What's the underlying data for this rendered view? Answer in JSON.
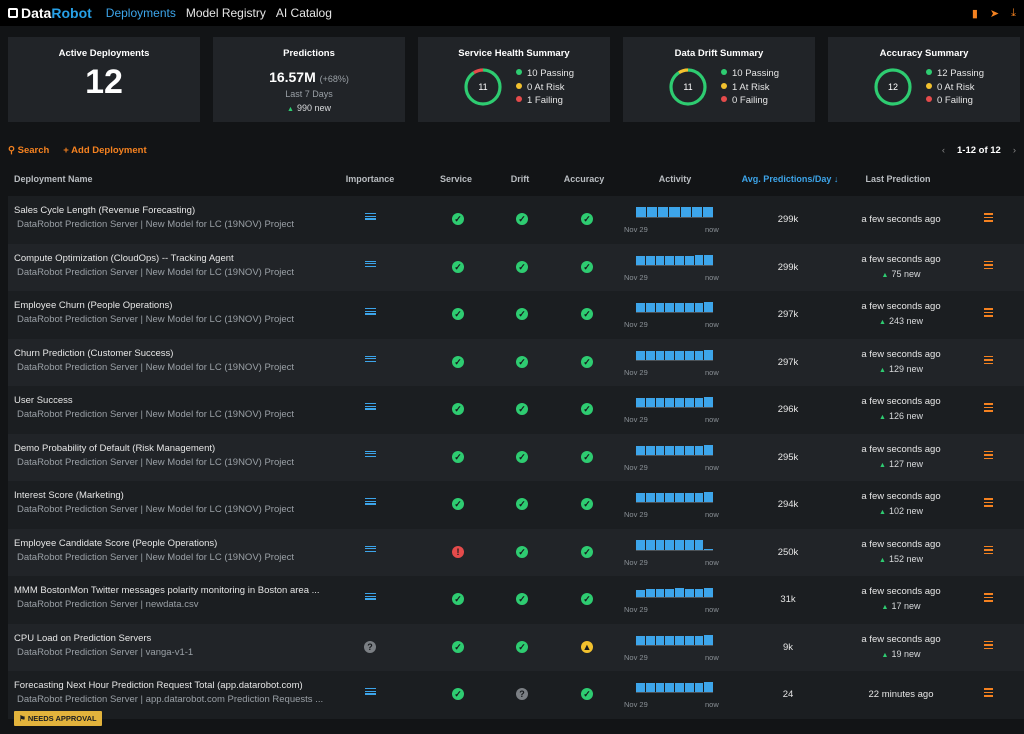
{
  "app": {
    "brand_part1": "Data",
    "brand_part2": "Robot",
    "nav": [
      "Deployments",
      "Model Registry",
      "AI Catalog"
    ]
  },
  "colors": {
    "accent_blue": "#3da5ea",
    "accent_orange": "#f58220",
    "pass": "#2ecc71",
    "risk": "#f2c12e",
    "fail": "#e54b4b"
  },
  "summary": {
    "active": {
      "title": "Active Deployments",
      "value": "12"
    },
    "predictions": {
      "title": "Predictions",
      "value": "16.57M",
      "change": "(+68%)",
      "period": "Last 7 Days",
      "new": "990 new"
    },
    "service": {
      "title": "Service Health Summary",
      "total": "11",
      "passing": "10 Passing",
      "at_risk": "0 At Risk",
      "failing": "1 Failing",
      "pass_count": 10,
      "risk_count": 0,
      "fail_count": 1
    },
    "drift": {
      "title": "Data Drift Summary",
      "total": "11",
      "passing": "10 Passing",
      "at_risk": "1 At Risk",
      "failing": "0 Failing",
      "pass_count": 10,
      "risk_count": 1,
      "fail_count": 0
    },
    "accuracy": {
      "title": "Accuracy Summary",
      "total": "12",
      "passing": "12 Passing",
      "at_risk": "0 At Risk",
      "failing": "0 Failing",
      "pass_count": 12,
      "risk_count": 0,
      "fail_count": 0
    }
  },
  "toolbar": {
    "search": "Search",
    "add": "Add Deployment",
    "pager": "1-12 of 12"
  },
  "table": {
    "headers": {
      "name": "Deployment Name",
      "importance": "Importance",
      "service": "Service",
      "drift": "Drift",
      "accuracy": "Accuracy",
      "activity": "Activity",
      "avg": "Avg. Predictions/Day",
      "last": "Last Prediction"
    },
    "activity_start": "Nov 29",
    "activity_end": "now",
    "rows": [
      {
        "name": "Sales Cycle Length (Revenue Forecasting)",
        "sub": "DataRobot Prediction Server | New Model for LC (19NOV) Project",
        "service": "ok",
        "drift": "ok",
        "accuracy": "ok",
        "importance": true,
        "activity": [
          0.8,
          0.8,
          0.8,
          0.8,
          0.8,
          0.8,
          0.85
        ],
        "avg": "299k",
        "last": "a few seconds ago",
        "new": ""
      },
      {
        "name": "Compute Optimization (CloudOps) -- Tracking Agent",
        "sub": "DataRobot Prediction Server | New Model for LC (19NOV) Project",
        "service": "ok",
        "drift": "ok",
        "accuracy": "ok",
        "importance": true,
        "activity": [
          0.75,
          0.75,
          0.75,
          0.75,
          0.75,
          0.75,
          0.8,
          0.8
        ],
        "avg": "299k",
        "last": "a few seconds ago",
        "new": "75 new"
      },
      {
        "name": "Employee Churn (People Operations)",
        "sub": "DataRobot Prediction Server | New Model for LC (19NOV) Project",
        "service": "ok",
        "drift": "ok",
        "accuracy": "ok",
        "importance": true,
        "activity": [
          0.75,
          0.75,
          0.75,
          0.75,
          0.75,
          0.75,
          0.75,
          0.8
        ],
        "avg": "297k",
        "last": "a few seconds ago",
        "new": "243 new"
      },
      {
        "name": "Churn Prediction (Customer Success)",
        "sub": "DataRobot Prediction Server | New Model for LC (19NOV) Project",
        "service": "ok",
        "drift": "ok",
        "accuracy": "ok",
        "importance": true,
        "activity": [
          0.75,
          0.75,
          0.75,
          0.75,
          0.75,
          0.75,
          0.75,
          0.8
        ],
        "avg": "297k",
        "last": "a few seconds ago",
        "new": "129 new"
      },
      {
        "name": "User Success",
        "sub": "DataRobot Prediction Server | New Model for LC (19NOV) Project",
        "service": "ok",
        "drift": "ok",
        "accuracy": "ok",
        "importance": true,
        "activity": [
          0.75,
          0.75,
          0.75,
          0.75,
          0.75,
          0.75,
          0.75,
          0.8
        ],
        "avg": "296k",
        "last": "a few seconds ago",
        "new": "126 new"
      },
      {
        "name": "Demo Probability of Default (Risk Management)",
        "sub": "DataRobot Prediction Server | New Model for LC (19NOV) Project",
        "service": "ok",
        "drift": "ok",
        "accuracy": "ok",
        "importance": true,
        "activity": [
          0.75,
          0.75,
          0.75,
          0.75,
          0.75,
          0.75,
          0.75,
          0.8
        ],
        "avg": "295k",
        "last": "a few seconds ago",
        "new": "127 new"
      },
      {
        "name": "Interest Score (Marketing)",
        "sub": "DataRobot Prediction Server | New Model for LC (19NOV) Project",
        "service": "ok",
        "drift": "ok",
        "accuracy": "ok",
        "importance": true,
        "activity": [
          0.75,
          0.75,
          0.75,
          0.75,
          0.75,
          0.75,
          0.75,
          0.8
        ],
        "avg": "294k",
        "last": "a few seconds ago",
        "new": "102 new"
      },
      {
        "name": "Employee Candidate Score (People Operations)",
        "sub": "DataRobot Prediction Server | New Model for LC (19NOV) Project",
        "service": "fail",
        "drift": "ok",
        "accuracy": "ok",
        "importance": true,
        "activity": [
          0.8,
          0.8,
          0.8,
          0.8,
          0.8,
          0.8,
          0.8,
          0.1
        ],
        "avg": "250k",
        "last": "a few seconds ago",
        "new": "152 new"
      },
      {
        "name": "MMM BostonMon Twitter messages polarity monitoring in Boston area ...",
        "sub": "DataRobot Prediction Server | newdata.csv",
        "service": "ok",
        "drift": "ok",
        "accuracy": "ok",
        "importance": true,
        "activity": [
          0.6,
          0.65,
          0.7,
          0.7,
          0.75,
          0.7,
          0.7,
          0.75
        ],
        "avg": "31k",
        "last": "a few seconds ago",
        "new": "17 new"
      },
      {
        "name": "CPU Load on Prediction Servers",
        "sub": "DataRobot Prediction Server | vanga-v1-1",
        "service": "ok",
        "drift": "ok",
        "accuracy": "warn",
        "importance": false,
        "activity": [
          0.75,
          0.75,
          0.75,
          0.75,
          0.75,
          0.75,
          0.75,
          0.8
        ],
        "avg": "9k",
        "last": "a few seconds ago",
        "new": "19 new"
      },
      {
        "name": "Forecasting Next Hour Prediction Request Total (app.datarobot.com)",
        "sub": "DataRobot Prediction Server | app.datarobot.com Prediction Requests ...",
        "service": "ok",
        "drift": "unk",
        "accuracy": "ok",
        "importance": true,
        "activity": [
          0.75,
          0.75,
          0.75,
          0.75,
          0.75,
          0.75,
          0.75,
          0.8
        ],
        "avg": "24",
        "last": "22 minutes ago",
        "new": "",
        "badge": "NEEDS APPROVAL"
      }
    ]
  }
}
